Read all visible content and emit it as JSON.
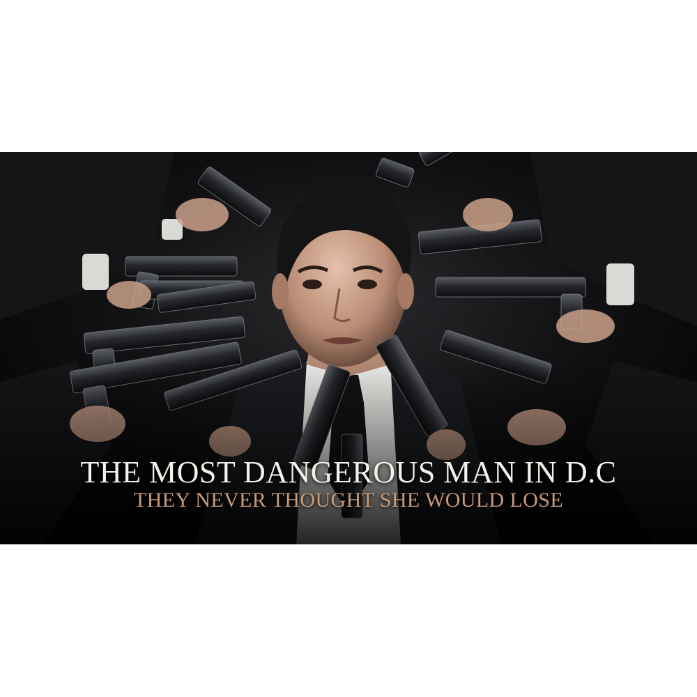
{
  "poster": {
    "title": "THE MOST DANGEROUS MAN IN D.C",
    "subtitle": "THEY NEVER THOUGHT SHE WOULD LOSE"
  },
  "colors": {
    "background": "#0b0b0c",
    "title_text": "#f4f1ea",
    "subtitle_text": "#c99a78",
    "page": "#ffffff"
  }
}
